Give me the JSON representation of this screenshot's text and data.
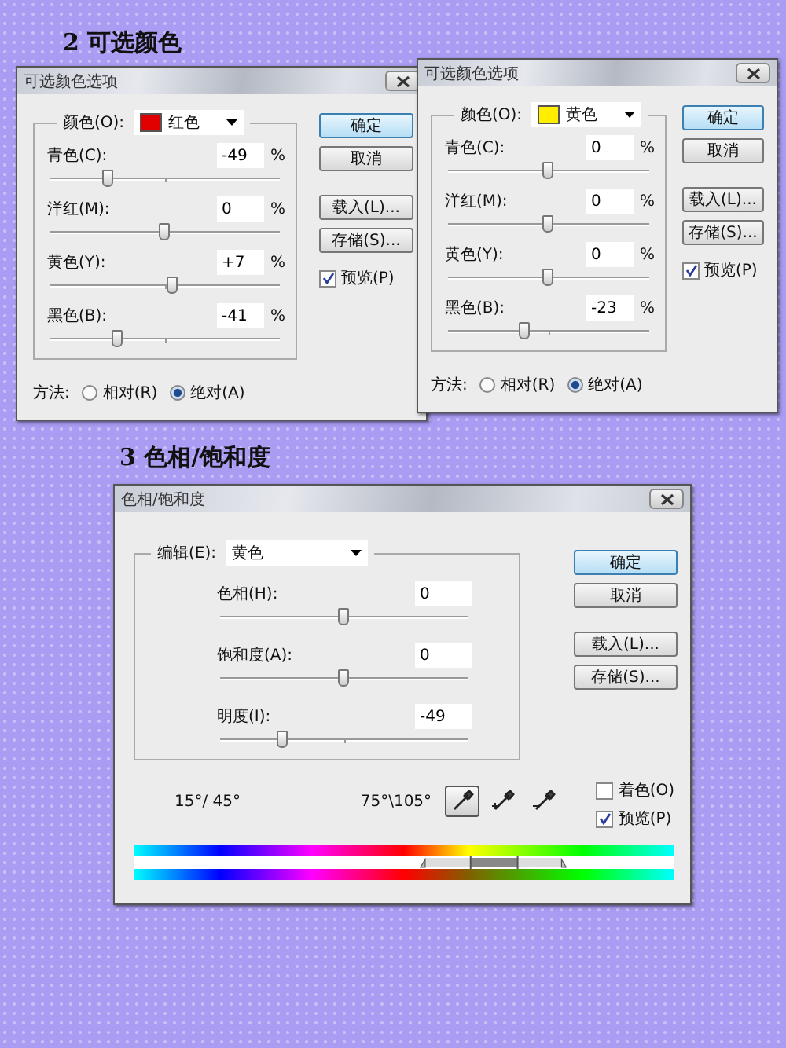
{
  "heading_1": "2 可选颜色",
  "selective_color_dialogs": [
    {
      "title": "可选颜色选项",
      "color_label": "颜色(O):",
      "color_value": "红色",
      "color": "#e00000",
      "sliders": [
        {
          "label": "青色(C):",
          "value": "-49",
          "unit": "%",
          "level": 0.255
        },
        {
          "label": "洋红(M):",
          "value": "0",
          "unit": "%",
          "level": 0.5
        },
        {
          "label": "黄色(Y):",
          "value": "+7",
          "unit": "%",
          "level": 0.535
        },
        {
          "label": "黑色(B):",
          "value": "-41",
          "unit": "%",
          "level": 0.295
        }
      ],
      "buttons": [
        {
          "label": "确定",
          "default": true
        },
        {
          "label": "取消",
          "default": false
        },
        {
          "label": "载入(L)...",
          "default": false
        },
        {
          "label": "存储(S)...",
          "default": false
        }
      ],
      "preview": {
        "label": "预览(P)",
        "checked": true
      },
      "method": {
        "label": "方法:",
        "options": [
          {
            "label": "相对(R)",
            "selected": false
          },
          {
            "label": "绝对(A)",
            "selected": true
          }
        ]
      }
    },
    {
      "title": "可选颜色选项",
      "color_label": "颜色(O):",
      "color_value": "黄色",
      "color": "#ffee00",
      "sliders": [
        {
          "label": "青色(C):",
          "value": "0",
          "unit": "%",
          "level": 0.5
        },
        {
          "label": "洋红(M):",
          "value": "0",
          "unit": "%",
          "level": 0.5
        },
        {
          "label": "黄色(Y):",
          "value": "0",
          "unit": "%",
          "level": 0.5
        },
        {
          "label": "黑色(B):",
          "value": "-23",
          "unit": "%",
          "level": 0.385
        }
      ],
      "buttons": [
        {
          "label": "确定",
          "default": true
        },
        {
          "label": "取消",
          "default": false
        },
        {
          "label": "载入(L)...",
          "default": false
        },
        {
          "label": "存储(S)...",
          "default": false
        }
      ],
      "preview": {
        "label": "预览(P)",
        "checked": true
      },
      "method": {
        "label": "方法:",
        "options": [
          {
            "label": "相对(R)",
            "selected": false
          },
          {
            "label": "绝对(A)",
            "selected": true
          }
        ]
      }
    }
  ],
  "heading_2": "3 色相/饱和度",
  "hue_saturation_dialog": {
    "title": "色相/饱和度",
    "edit_label": "编辑(E):",
    "edit_value": "黄色",
    "sliders": [
      {
        "label": "色相(H):",
        "value": "0",
        "level": 0.5
      },
      {
        "label": "饱和度(A):",
        "value": "0",
        "level": 0.5
      },
      {
        "label": "明度(I):",
        "value": "-49",
        "level": 0.255
      }
    ],
    "buttons": [
      {
        "label": "确定",
        "default": true
      },
      {
        "label": "取消",
        "default": false
      },
      {
        "label": "载入(L)...",
        "default": false
      },
      {
        "label": "存储(S)...",
        "default": false
      }
    ],
    "range_left": "15°/ 45°",
    "range_right": "75°\\105°",
    "eyedroppers": [
      {
        "kind": "sample",
        "selected": true
      },
      {
        "kind": "add",
        "selected": false
      },
      {
        "kind": "subtract",
        "selected": false
      }
    ],
    "checkboxes": [
      {
        "label": "着色(O)",
        "checked": false
      },
      {
        "label": "预览(P)",
        "checked": true
      }
    ]
  }
}
